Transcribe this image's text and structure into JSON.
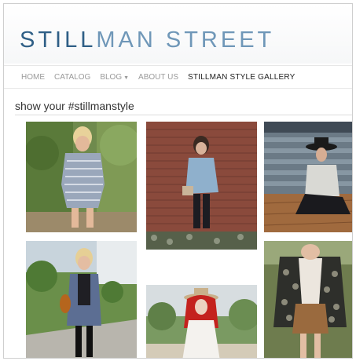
{
  "header": {
    "logo_part1": "STILL",
    "logo_part2": "MAN STREET"
  },
  "nav": {
    "items": [
      {
        "label": "HOME"
      },
      {
        "label": "CATALOG"
      },
      {
        "label": "BLOG"
      },
      {
        "label": "ABOUT US"
      },
      {
        "label": "STILLMAN STYLE GALLERY"
      }
    ],
    "blog_dropdown_icon": "caret-down-icon"
  },
  "gallery": {
    "heading": "show your #stillmanstyle",
    "photos": [
      {
        "subject": "woman in striped off-shoulder romper"
      },
      {
        "subject": "woman in denim shirt by brick wall"
      },
      {
        "subject": "woman in wide-brim hat sitting on deck"
      },
      {
        "subject": "woman in long cardigan and knee socks"
      },
      {
        "subject": "red-haired woman in white dress with hat"
      },
      {
        "subject": "woman in patterned jacket and suede skirt"
      }
    ]
  }
}
